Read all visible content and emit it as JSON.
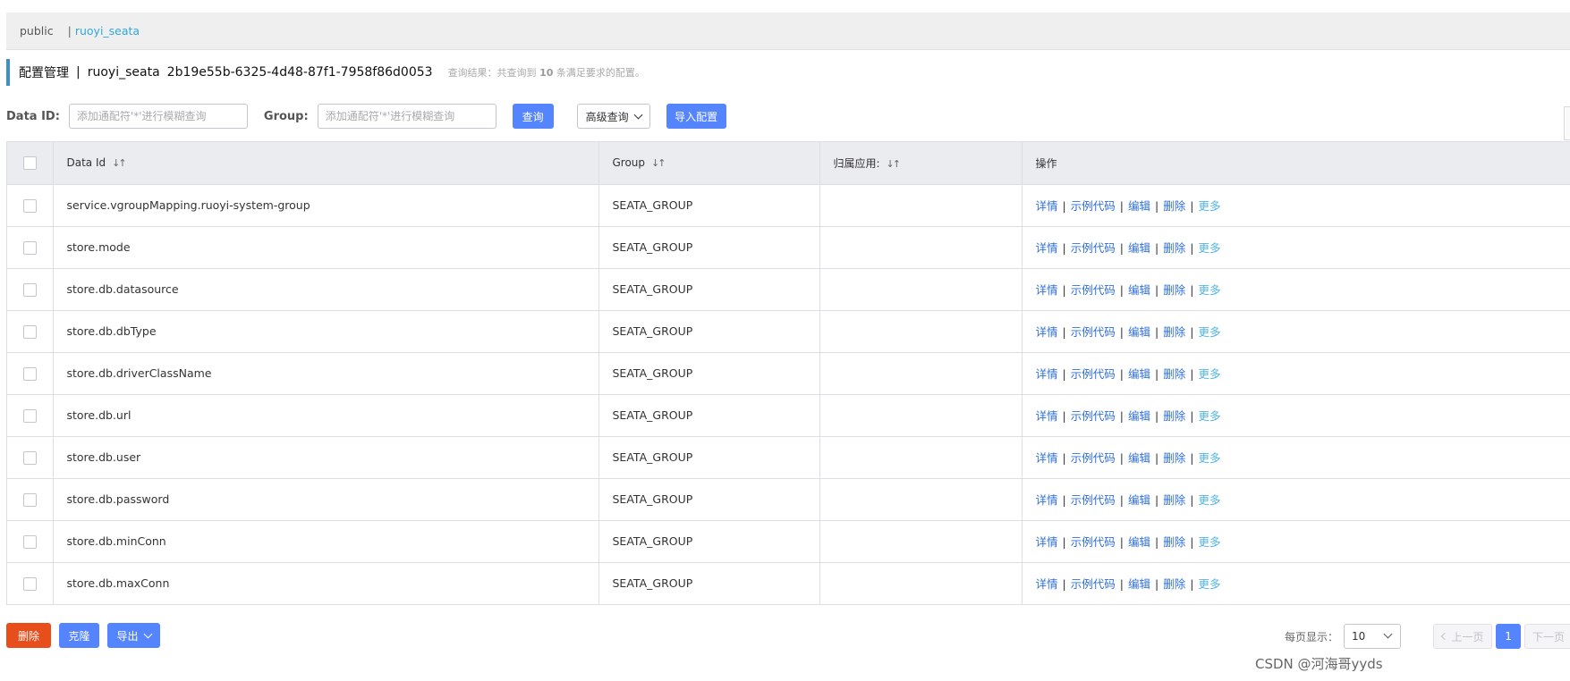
{
  "namespace_bar": {
    "public_label": "public",
    "separator": "|",
    "current": "ruoyi_seata"
  },
  "header": {
    "title": "配置管理",
    "separator": "|",
    "namespace": "ruoyi_seata",
    "namespace_id": "2b19e55b-6325-4d48-87f1-7958f86d0053",
    "result_prefix": "查询结果：共查询到",
    "result_count": "10",
    "result_suffix": "条满足要求的配置。"
  },
  "search": {
    "data_id_label": "Data ID:",
    "data_id_placeholder": "添加通配符'*'进行模糊查询",
    "group_label": "Group:",
    "group_placeholder": "添加通配符'*'进行模糊查询",
    "query_button": "查询",
    "advanced_button": "高级查询",
    "import_button": "导入配置"
  },
  "table": {
    "columns": {
      "data_id": "Data Id",
      "group": "Group",
      "app": "归属应用:",
      "ops": "操作"
    },
    "actions": {
      "detail": "详情",
      "sample": "示例代码",
      "edit": "编辑",
      "delete": "删除",
      "more": "更多"
    },
    "rows": [
      {
        "data_id": "service.vgroupMapping.ruoyi-system-group",
        "group": "SEATA_GROUP",
        "app": ""
      },
      {
        "data_id": "store.mode",
        "group": "SEATA_GROUP",
        "app": ""
      },
      {
        "data_id": "store.db.datasource",
        "group": "SEATA_GROUP",
        "app": ""
      },
      {
        "data_id": "store.db.dbType",
        "group": "SEATA_GROUP",
        "app": ""
      },
      {
        "data_id": "store.db.driverClassName",
        "group": "SEATA_GROUP",
        "app": ""
      },
      {
        "data_id": "store.db.url",
        "group": "SEATA_GROUP",
        "app": ""
      },
      {
        "data_id": "store.db.user",
        "group": "SEATA_GROUP",
        "app": ""
      },
      {
        "data_id": "store.db.password",
        "group": "SEATA_GROUP",
        "app": ""
      },
      {
        "data_id": "store.db.minConn",
        "group": "SEATA_GROUP",
        "app": ""
      },
      {
        "data_id": "store.db.maxConn",
        "group": "SEATA_GROUP",
        "app": ""
      }
    ]
  },
  "footer": {
    "delete_button": "删除",
    "clone_button": "克隆",
    "export_button": "导出",
    "per_page_label": "每页显示：",
    "per_page_value": "10",
    "prev_button": "上一页",
    "current_page": "1",
    "next_button": "下一页"
  },
  "watermark": "CSDN @河海哥yyds",
  "colors": {
    "primary": "#5584ff",
    "danger": "#e84d1c",
    "link": "#2f6fdc",
    "link_more": "#50b5e8",
    "namespace_active": "#33a7d8",
    "title_accent": "#3c8fc9"
  }
}
